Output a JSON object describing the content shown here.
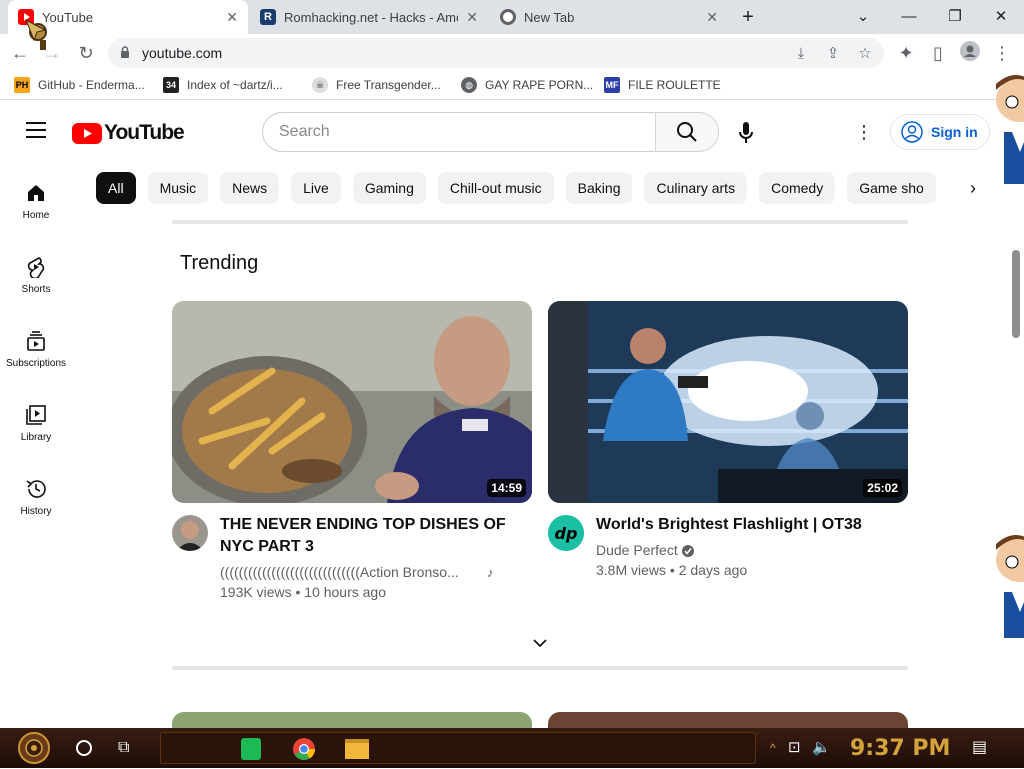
{
  "browser": {
    "tabs": [
      {
        "title": "YouTube",
        "active": true
      },
      {
        "title": "Romhacking.net - Hacks - Amo",
        "active": false
      },
      {
        "title": "New Tab",
        "active": false
      }
    ],
    "url": "youtube.com",
    "bookmarks": [
      {
        "label": "GitHub - Enderma...",
        "icon": "PH"
      },
      {
        "label": "Index of ~dartz/i...",
        "icon": "34"
      },
      {
        "label": "Free Transgender...",
        "icon": "skull-icon"
      },
      {
        "label": "GAY RAPE PORN...",
        "icon": "globe-icon"
      },
      {
        "label": "FILE ROULETTE",
        "icon": "MF"
      }
    ]
  },
  "youtube": {
    "logo": "YouTube",
    "search_placeholder": "Search",
    "signin_label": "Sign in",
    "chips": [
      "All",
      "Music",
      "News",
      "Live",
      "Gaming",
      "Chill-out music",
      "Baking",
      "Culinary arts",
      "Comedy",
      "Game sho"
    ],
    "sidebar": [
      {
        "label": "Home"
      },
      {
        "label": "Shorts"
      },
      {
        "label": "Subscriptions"
      },
      {
        "label": "Library"
      },
      {
        "label": "History"
      }
    ],
    "section_title": "Trending",
    "videos": [
      {
        "title": "THE NEVER ENDING TOP DISHES OF NYC PART 3",
        "channel": "((((((((((((((((((((((((((((((Action Bronso...",
        "stats": "193K views • 10 hours ago",
        "duration": "14:59"
      },
      {
        "title": "World's Brightest Flashlight | OT38",
        "channel": "Dude Perfect",
        "stats": "3.8M views • 2 days ago",
        "duration": "25:02"
      }
    ]
  },
  "taskbar": {
    "clock": "9:37 PM"
  },
  "colors": {
    "yt_red": "#ff0000",
    "link_blue": "#065fd4",
    "clock_gold": "#d4a33b"
  }
}
